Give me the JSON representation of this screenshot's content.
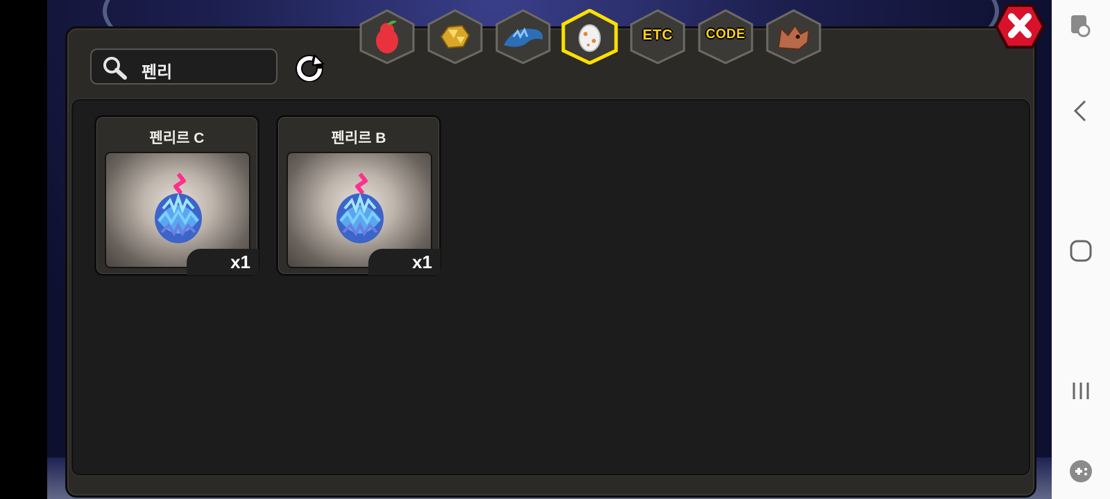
{
  "search": {
    "value": "펜리"
  },
  "tabs": [
    {
      "name": "fruit",
      "icon": "fruit-icon",
      "selected": false
    },
    {
      "name": "gold",
      "icon": "gold-ore-icon",
      "selected": false
    },
    {
      "name": "dragon",
      "icon": "blue-dragon-icon",
      "selected": false
    },
    {
      "name": "egg",
      "icon": "egg-icon",
      "selected": true
    },
    {
      "name": "etc",
      "label": "ETC",
      "selected": false
    },
    {
      "name": "code",
      "label": "CODE",
      "selected": false
    },
    {
      "name": "beast",
      "icon": "wolf-head-icon",
      "selected": false
    }
  ],
  "items": [
    {
      "title": "펜리르 C",
      "qty": "x1",
      "icon": "fenrir-egg-icon"
    },
    {
      "title": "펜리르 B",
      "qty": "x1",
      "icon": "fenrir-egg-icon"
    }
  ],
  "colors": {
    "panel": "#2b2a27",
    "grid": "#1c1c1c",
    "tab_selected_border": "#ffe000",
    "tab_label": "#ffd21a",
    "close_red": "#d8122a"
  },
  "nav_bar": [
    "screen-touch-icon",
    "back-icon",
    "home-icon",
    "recents-icon",
    "game-tools-icon"
  ]
}
